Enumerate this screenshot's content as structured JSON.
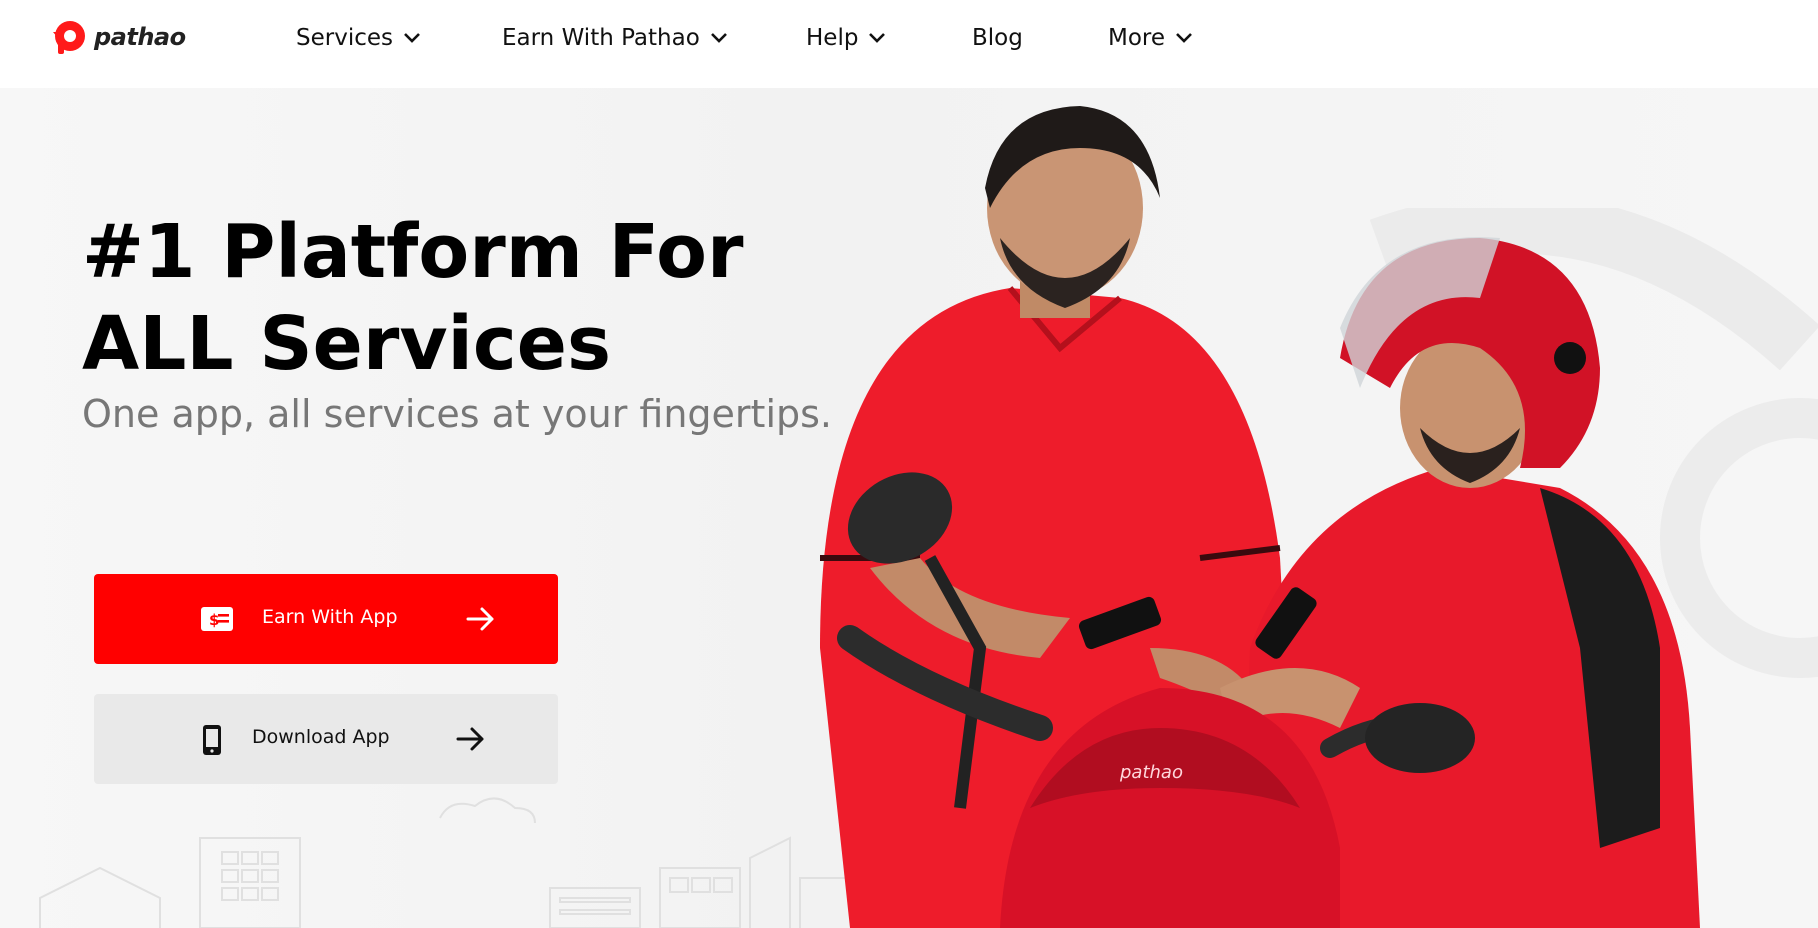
{
  "brand": {
    "name": "pathao",
    "accent": "#ff0000"
  },
  "nav": {
    "items": [
      {
        "label": "Services",
        "has_dropdown": true
      },
      {
        "label": "Earn With Pathao",
        "has_dropdown": true
      },
      {
        "label": "Help",
        "has_dropdown": true
      },
      {
        "label": "Blog",
        "has_dropdown": false
      },
      {
        "label": "More",
        "has_dropdown": true
      }
    ]
  },
  "hero": {
    "title_line1": "#1 Platform For",
    "title_line2": "ALL Services",
    "subtitle": "One app, all services at your fingertips.",
    "earn_button": {
      "label": "Earn With App",
      "icon": "money-card-icon",
      "arrow": "arrow-right-icon"
    },
    "download_button": {
      "label": "Download App",
      "icon": "phone-icon",
      "arrow": "arrow-right-icon"
    },
    "helmet_brand": "pathao"
  }
}
